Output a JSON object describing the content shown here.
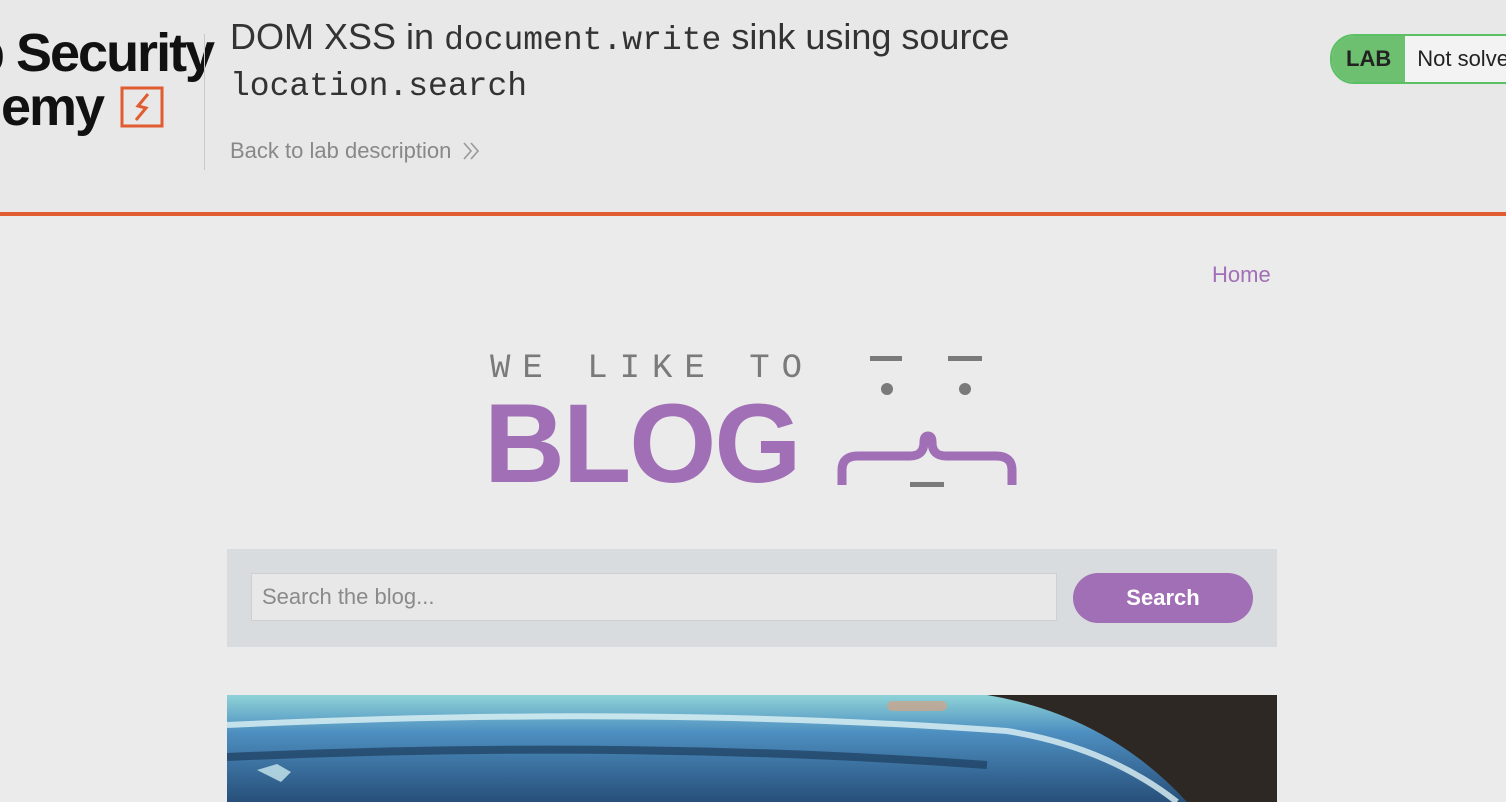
{
  "academy_header": {
    "logo": {
      "line1": "b Security",
      "line2": "demy"
    },
    "lab_title_parts": [
      {
        "text": "DOM XSS in ",
        "code": false
      },
      {
        "text": "document.write",
        "code": true
      },
      {
        "text": " sink using source",
        "code": false
      },
      {
        "text": "location.search",
        "code": true
      }
    ],
    "back_link": "Back to lab description",
    "lab_badge": "LAB",
    "lab_status": "Not solved"
  },
  "nav": {
    "home": "Home"
  },
  "blog_logo": {
    "tagline": "WE LIKE TO",
    "word": "BLOG"
  },
  "search": {
    "placeholder": "Search the blog...",
    "button": "Search"
  },
  "colors": {
    "accent": "#a16fb6",
    "brand_orange": "#e15c30",
    "lab_green": "#6cc06f"
  }
}
